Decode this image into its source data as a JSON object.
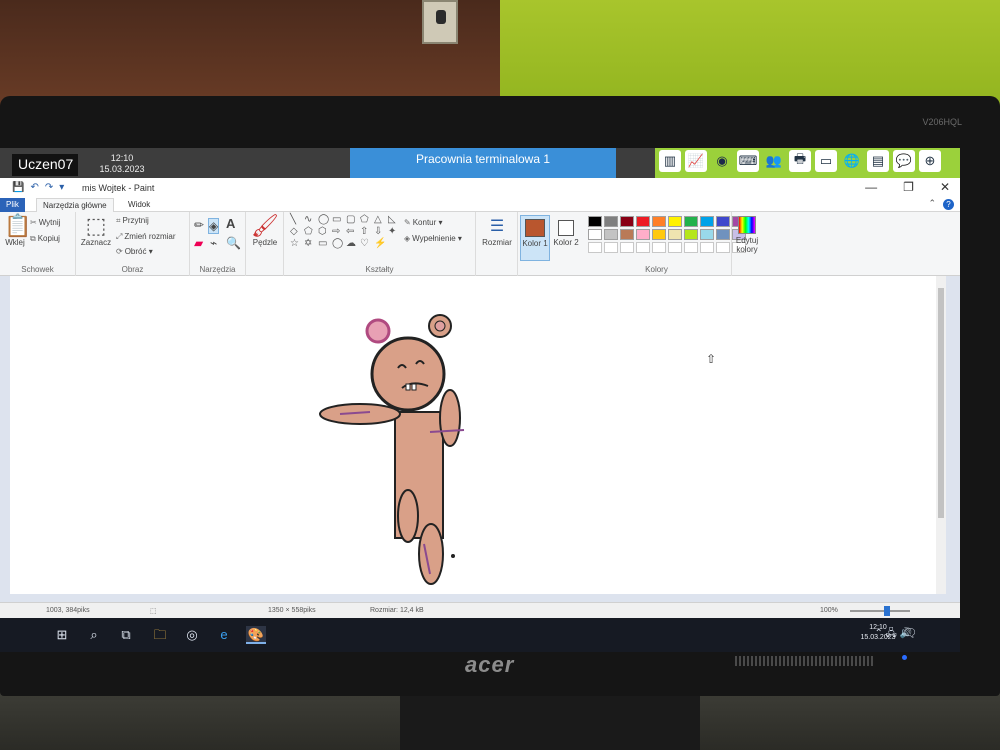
{
  "teacher_bar": {
    "user": "Uczen07",
    "time": "12:10",
    "date": "15.03.2023",
    "title": "Pracownia terminalowa 1",
    "tools": [
      "chart-icon",
      "line-chart-icon",
      "disc-icon",
      "keyboard-icon",
      "users-icon",
      "printer-icon",
      "window-icon",
      "globe-icon",
      "document-icon",
      "message-icon",
      "lifebuoy-icon"
    ]
  },
  "window": {
    "title": "mis Wojtek - Paint",
    "controls": {
      "minimize": "—",
      "maximize": "❐",
      "close": "✕"
    }
  },
  "tabs": {
    "file": "Plik",
    "home": "Narzędzia główne",
    "view": "Widok"
  },
  "ribbon": {
    "clipboard": {
      "label": "Schowek",
      "paste": "Wklej",
      "cut": "Wytnij",
      "copy": "Kopiuj"
    },
    "image": {
      "label": "Obraz",
      "select": "Zaznacz",
      "crop": "Przytnij",
      "resize": "Zmień rozmiar",
      "rotate": "Obróć ▾"
    },
    "tools": {
      "label": "Narzędzia"
    },
    "brushes": {
      "label": "Pędzle"
    },
    "shapes": {
      "label": "Kształty",
      "outline": "Kontur ▾",
      "fill": "Wypełnienie ▾"
    },
    "size": {
      "label": "Rozmiar"
    },
    "colors": {
      "label": "Kolory",
      "color1": "Kolor 1",
      "color2": "Kolor 2",
      "edit": "Edytuj kolory",
      "row1": [
        "#000000",
        "#7f7f7f",
        "#880015",
        "#ed1c24",
        "#ff7f27",
        "#fff200",
        "#22b14c",
        "#00a2e8",
        "#3f48cc",
        "#a349a4"
      ],
      "row2": [
        "#ffffff",
        "#c3c3c3",
        "#b97a57",
        "#ffaec9",
        "#ffc90e",
        "#efe4b0",
        "#b5e61d",
        "#99d9ea",
        "#7092be",
        "#c8bfe7"
      ],
      "color1_value": "#b9562e"
    }
  },
  "status": {
    "cursor_pos": "1003, 384piks",
    "selection_size": "1350 × 558piks",
    "file_size": "Rozmiar: 12,4 kB",
    "zoom": "100%"
  },
  "taskbar": {
    "time": "12:10",
    "date": "15.03.2023"
  },
  "monitor": {
    "brand": "acer",
    "model": "V206HQL"
  }
}
